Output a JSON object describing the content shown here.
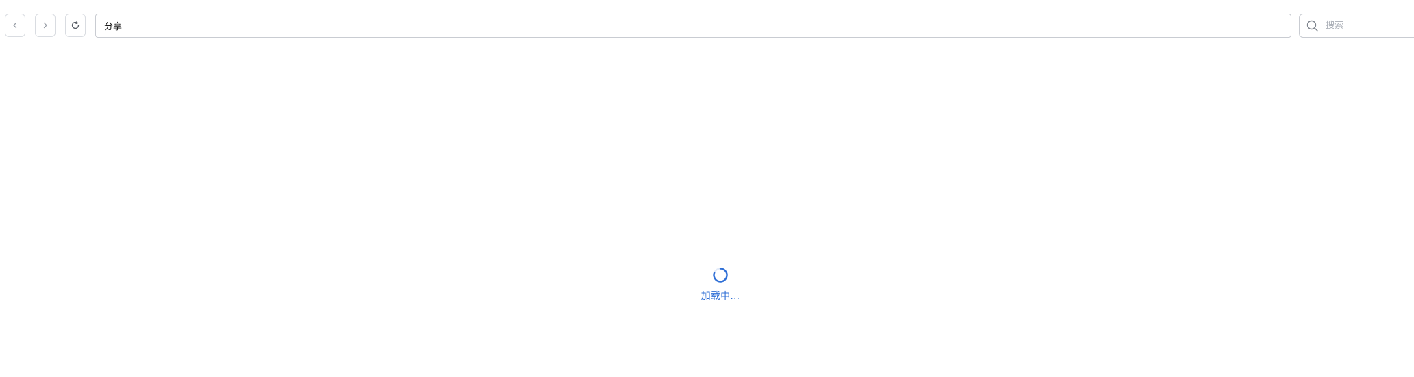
{
  "toolbar": {
    "back_icon": "chevron-left-icon",
    "forward_icon": "chevron-right-icon",
    "refresh_icon": "refresh-icon",
    "address": "分享",
    "search": {
      "placeholder": "搜索",
      "value": "",
      "icon": "search-icon"
    }
  },
  "main": {
    "loading_text": "加载中...",
    "spinner_icon": "spinner-icon"
  },
  "colors": {
    "accent": "#2f6fd6",
    "border": "#d9dce1",
    "placeholder": "#a8adb5"
  }
}
